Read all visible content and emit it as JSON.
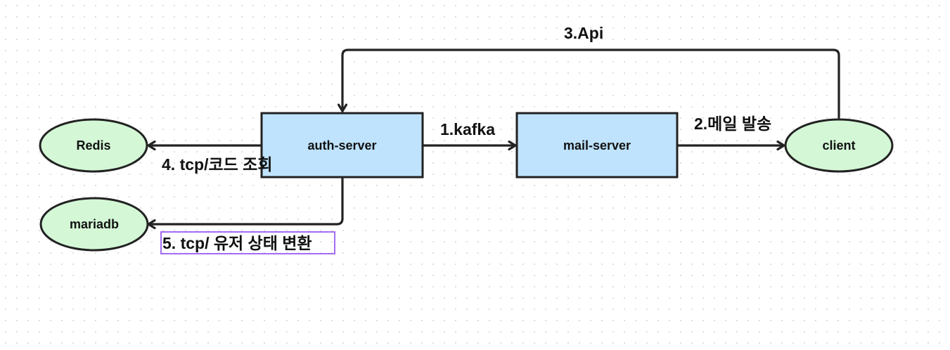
{
  "colors": {
    "server_fill": "#bfe3fd",
    "datastore_fill": "#d4f8d6",
    "outline": "#222222",
    "selection": "#a36cf2",
    "text": "#111111"
  },
  "nodes": {
    "redis": "Redis",
    "mariadb": "mariadb",
    "auth_server": "auth-server",
    "mail_server": "mail-server",
    "client": "client"
  },
  "edges": {
    "kafka": "1.kafka",
    "mail_send": "2.메일 발송",
    "api": "3.Api",
    "tcp_code": "4. tcp/코드 조회",
    "tcp_user": "5. tcp/ 유저 상태 변환"
  }
}
